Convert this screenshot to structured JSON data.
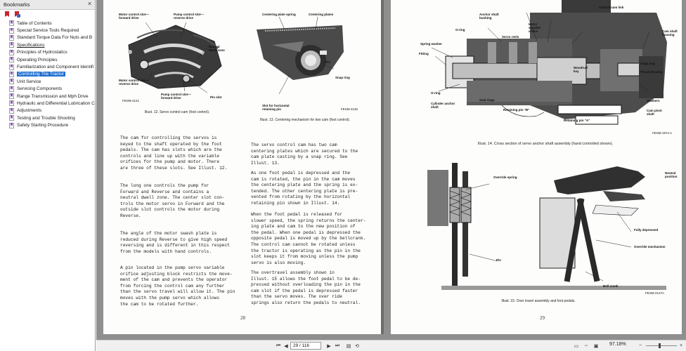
{
  "sidebar": {
    "title": "Bookmarks",
    "close_glyph": "✕",
    "tools": [
      "bookmark-options-icon",
      "new-bookmark-icon"
    ],
    "items": [
      {
        "label": "Table of Contents"
      },
      {
        "label": "Special Service Tools Required"
      },
      {
        "label": "Standard Torque Data For Nuts and B"
      },
      {
        "label": "Specifications"
      },
      {
        "label": "Principles of Hydrostatics"
      },
      {
        "label": "Operating Principles"
      },
      {
        "label": "Familiarization and Component Identifi"
      },
      {
        "label": "Controlling The Tractor"
      },
      {
        "label": "Unit Service"
      },
      {
        "label": "Servicing Components"
      },
      {
        "label": "Range Transmission and Mph Drive"
      },
      {
        "label": "Hydraulic and Differential Lubrication C"
      },
      {
        "label": "Adjustments"
      },
      {
        "label": "Testing and Trouble Shooting"
      },
      {
        "label": "Safety Starting Procedure"
      }
    ]
  },
  "page28": {
    "fig12": {
      "labels": {
        "a": "Motor control slot—\nforward drive",
        "b": "Pump control slot—\nreverse drive",
        "c": "Neutral\ndwell zone",
        "d": "Motor control slot—\nreverse drive",
        "e": "Pump control slot—\nforward drive",
        "f": "Pin slot",
        "code": "FESM-2121"
      },
      "caption": "Illust. 12. Servo control cam (foot control)."
    },
    "fig13": {
      "labels": {
        "a": "Centering plate spring",
        "b": "Centering plates",
        "c": "Pin",
        "d": "Snap ring",
        "e": "Slot for horizontal\nretaining pin",
        "code": "FESM-2126"
      },
      "caption": "Illust. 13. Centering mechanism for two cam\n(foot control)."
    },
    "left_paras": [
      "The cam for controlling the servos is\nkeyed to the shaft operated by the foot\npedals. The cam has slots which are the\ncontrols and line up with the variable\norifices for the pump and motor. There\nare three of these slots. See Illust. 12.",
      "The long one controls the pump for\nForward and Reverse and contains a\nneutral dwell zone. The center slot con-\ntrols the motor servo in Forward and the\noutside slot controls the motor during\nReverse.",
      "The angle of the motor swash plate is\nreduced during Reverse to give high speed\nreversing and is different in this respect\nfrom the models with hand controls.",
      "A pin located in the pump servo variable\norifice adjusting block restricts the move-\nment of the cam and prevents the operator\nfrom forcing the control cam any further\nthan the servo travel will allow it. The pin\nmoves with the pump servo which allows\nthe cam to be rotated further."
    ],
    "right_paras": [
      "The servo control cam has two cam\ncentering plates which are secured to the\ncam plate casting by a snap ring. See\nIllust. 13.",
      "As one foot pedal is depressed and the\ncam is rotated, the pin in the cam moves\nthe centering plate and the spring is ex-\ntended. The other centering plate is pre-\nvented from rotating by the horizontal\nretaining pin shown in Illust. 14.",
      "When the foot pedal is released for\nslower speed, the spring returns the center-\ning plate and cam to the new position of\nthe pedal. When one pedal is depressed the\nopposite pedal is moved up by the bellcrank.\nThe control cam cannot be rotated unless\nthe tractor is operating as the pin in the\nslot keeps it from moving unless the pump\nservo is also moving.",
      "The overtravel assembly shown in\nIllust. 15 allows the foot pedal to be de-\npressed without overloading the pin in the\ncam slot if the pedal is depressed faster\nthan the servo moves. The over ride\nsprings also return the pedals to neutral."
    ],
    "page_number": "28"
  },
  "page29": {
    "fig14": {
      "labels": {
        "top": "Control cam link",
        "anchor": "Anchor shaft\nbushing",
        "motor": "Motor\nvariable\norifice",
        "oring1": "O-ring",
        "reels": "Servo reels",
        "cam_housing": "Cam shaft\nhousing",
        "spring_washer": "Spring washer",
        "fitting": "Fitting",
        "woodruff": "Woodruff\nkey",
        "snap": "Snap ring",
        "thrust": "Thrust bearing",
        "oring2": "O-ring",
        "cyl": "Cylinder anchor\nshaft",
        "seal": "Seal rings",
        "pinb": "Retaining pin \"B\"",
        "pina": "Retaining pin \"A\"",
        "washers": "Washers",
        "cam_pivot": "Cam pivot\nshaft",
        "code": "FESM-1974 A"
      },
      "caption": "Illust. 14. Cross section of servo anchor shaft assembly (hand controlled shown)."
    },
    "fig15": {
      "labels": {
        "override": "Override spring",
        "neutral": "Neutral\nposition",
        "pin": "Pin",
        "fully": "Fully depressed",
        "mech": "Override mechanism",
        "bell": "Bell crank",
        "code": "FESM-2127A"
      },
      "caption": "Illust. 15. Over travel assembly and foot pedals."
    },
    "page_number": "29"
  },
  "statusbar": {
    "page_value": "29 / 116",
    "zoom": "97.18%"
  }
}
